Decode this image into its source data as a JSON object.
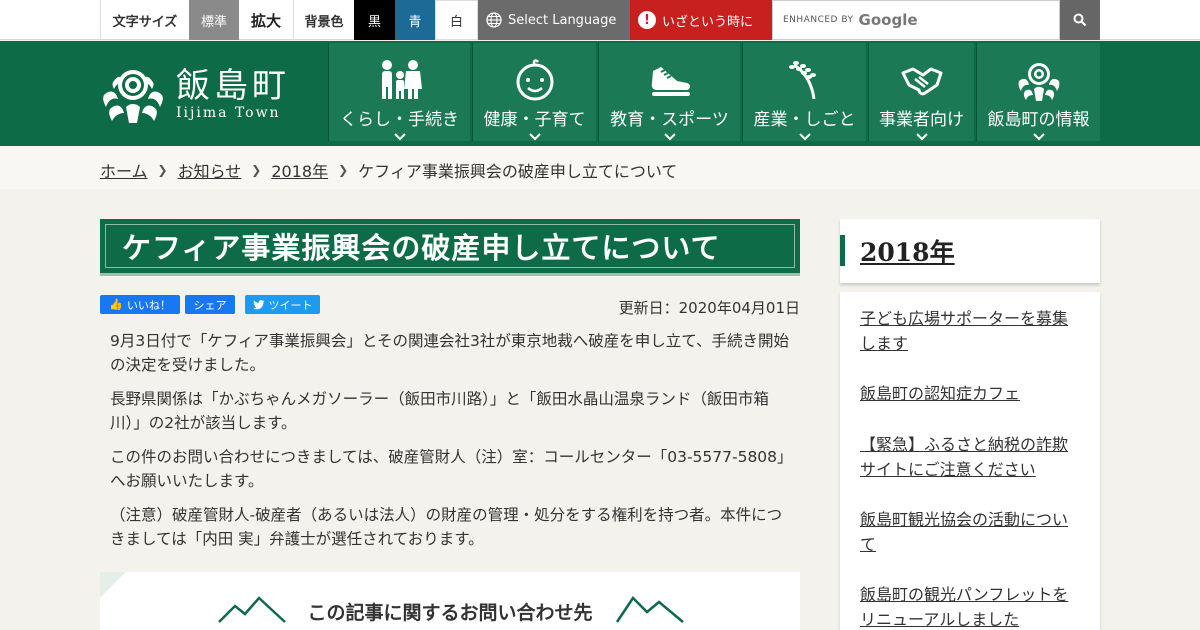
{
  "topbar": {
    "font_size_label": "文字サイズ",
    "font_standard": "標準",
    "font_large": "拡大",
    "bg_color_label": "背景色",
    "bg_black": "黒",
    "bg_blue": "青",
    "bg_white": "白",
    "language": "Select Language",
    "emergency": "いざという時に",
    "emergency_mark": "!",
    "search_enhanced": "ENHANCED BY",
    "search_brand": "Google",
    "search_icon": "magnifier"
  },
  "header": {
    "logo_jp": "飯島町",
    "logo_en": "Iijima Town",
    "nav": [
      {
        "label": "くらし・手続き",
        "icon": "family-icon"
      },
      {
        "label": "健康・子育て",
        "icon": "baby-face-icon"
      },
      {
        "label": "教育・スポーツ",
        "icon": "sneaker-icon"
      },
      {
        "label": "産業・しごと",
        "icon": "rice-plant-icon"
      },
      {
        "label": "事業者向け",
        "icon": "handshake-icon"
      },
      {
        "label": "飯島町の情報",
        "icon": "town-emblem-icon"
      }
    ]
  },
  "breadcrumb": {
    "home": "ホーム",
    "news": "お知らせ",
    "year": "2018年",
    "current": "ケフィア事業振興会の破産申し立てについて"
  },
  "article": {
    "title": "ケフィア事業振興会の破産申し立てについて",
    "like_label": "いいね！",
    "share_label": "シェア",
    "tweet_label": "ツイート",
    "updated": "更新日：2020年04月01日",
    "paragraphs": [
      "9月3日付で「ケフィア事業振興会」とその関連会社3社が東京地裁へ破産を申し立て、手続き開始の決定を受けました。",
      "長野県関係は「かぶちゃんメガソーラー（飯田市川路）」と「飯田水晶山温泉ランド（飯田市箱川）」の2社が該当します。",
      "この件のお問い合わせにつきましては、破産管財人（注）室：コールセンター「03-5577-5808」へお願いいたします。",
      "（注意）破産管財人-破産者（あるいは法人）の財産の管理・処分をする権利を持つ者。本件につきましては「内田 実」弁護士が選任されております。"
    ],
    "contact_title": "この記事に関するお問い合わせ先"
  },
  "sidebar": {
    "heading": "2018年",
    "items": [
      "子ども広場サポーターを募集します",
      "飯島町の認知症カフェ",
      "【緊急】ふるさと納税の詐欺サイトにご注意ください",
      "飯島町観光協会の活動について",
      "飯島町の観光パンフレットをリニューアルしました"
    ]
  },
  "colors": {
    "brand_green": "#0d6b47",
    "nav_green": "#1b7a55",
    "emergency_red": "#c8201f",
    "facebook_blue": "#1877f2",
    "twitter_blue": "#1d9bf0"
  }
}
